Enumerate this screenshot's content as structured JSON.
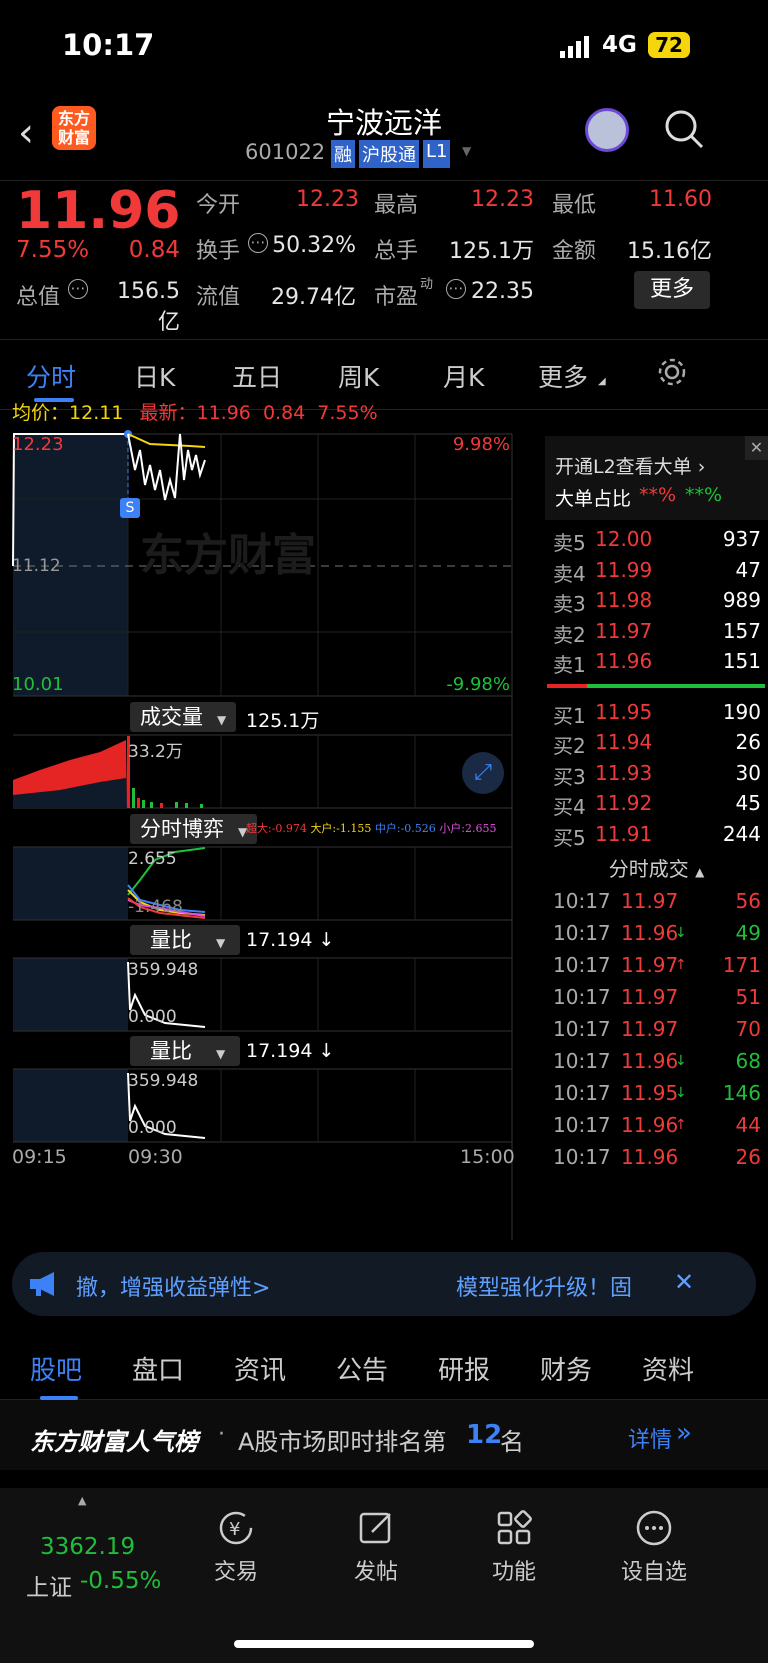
{
  "status": {
    "time": "10:17",
    "network": "4G",
    "battery": "72"
  },
  "header": {
    "logo": "东方财富",
    "name": "宁波远洋",
    "code": "601022",
    "tags": [
      "融",
      "沪股通",
      "L1"
    ]
  },
  "quote": {
    "price": "11.96",
    "pct": "7.55%",
    "change": "0.84",
    "fields": [
      {
        "label": "今开",
        "value": "12.23"
      },
      {
        "label": "最高",
        "value": "12.23"
      },
      {
        "label": "最低",
        "value": "11.60"
      },
      {
        "label": "换手",
        "value": "50.32%"
      },
      {
        "label": "总手",
        "value": "125.1万"
      },
      {
        "label": "金额",
        "value": "15.16亿"
      },
      {
        "label": "总值",
        "value": "156.5亿"
      },
      {
        "label": "流值",
        "value": "29.74亿"
      },
      {
        "label": "市盈",
        "sup": "动",
        "value": "22.35"
      }
    ],
    "more": "更多"
  },
  "tabs": [
    "分时",
    "日K",
    "五日",
    "周K",
    "月K",
    "更多"
  ],
  "chart": {
    "avg_label": "均价：",
    "avg": "12.11",
    "latest_label": "最新：",
    "latest": "11.96",
    "latest_chg": "0.84",
    "latest_pct": "7.55%",
    "price_high": "12.23",
    "price_mid": "11.12",
    "price_low": "10.01",
    "pct_high": "9.98%",
    "pct_low": "-9.98%",
    "watermark": "东方财富",
    "s_marker": "S",
    "vol_label": "成交量",
    "vol_value": "125.1万",
    "vol_max": "33.2万",
    "game_label": "分时博弈",
    "game_legend": [
      {
        "k": "超大:",
        "v": "-0.974"
      },
      {
        "k": "大户:",
        "v": "-1.155"
      },
      {
        "k": "中户:",
        "v": "-0.526"
      },
      {
        "k": "小户:",
        "v": "2.655"
      }
    ],
    "game_max": "2.655",
    "game_min": "-1.468",
    "ratio_label": "量比",
    "ratio_value": "17.194 ↓",
    "ratio_max": "359.948",
    "ratio_min": "0.000",
    "ratio2_label": "量比",
    "ratio2_value": "17.194 ↓",
    "ratio2_max": "359.948",
    "ratio2_min": "0.000",
    "time_start": "09:15",
    "time_open": "09:30",
    "time_end": "15:00"
  },
  "l2": {
    "line1": "开通L2查看大单 ›",
    "line2_label": "大单占比",
    "red": "**%",
    "green": "**%"
  },
  "book": {
    "asks": [
      {
        "l": "卖5",
        "p": "12.00",
        "v": "937"
      },
      {
        "l": "卖4",
        "p": "11.99",
        "v": "47"
      },
      {
        "l": "卖3",
        "p": "11.98",
        "v": "989"
      },
      {
        "l": "卖2",
        "p": "11.97",
        "v": "157"
      },
      {
        "l": "卖1",
        "p": "11.96",
        "v": "151"
      }
    ],
    "bids": [
      {
        "l": "买1",
        "p": "11.95",
        "v": "190"
      },
      {
        "l": "买2",
        "p": "11.94",
        "v": "26"
      },
      {
        "l": "买3",
        "p": "11.93",
        "v": "30"
      },
      {
        "l": "买4",
        "p": "11.92",
        "v": "45"
      },
      {
        "l": "买5",
        "p": "11.91",
        "v": "244"
      }
    ],
    "trades_title": "分时成交",
    "trades": [
      {
        "t": "10:17",
        "p": "11.97",
        "a": "",
        "v": "56",
        "vc": "red"
      },
      {
        "t": "10:17",
        "p": "11.96",
        "a": "↓",
        "v": "49",
        "vc": "green"
      },
      {
        "t": "10:17",
        "p": "11.97",
        "a": "↑",
        "v": "171",
        "vc": "red"
      },
      {
        "t": "10:17",
        "p": "11.97",
        "a": "",
        "v": "51",
        "vc": "red"
      },
      {
        "t": "10:17",
        "p": "11.97",
        "a": "",
        "v": "70",
        "vc": "red"
      },
      {
        "t": "10:17",
        "p": "11.96",
        "a": "↓",
        "v": "68",
        "vc": "green"
      },
      {
        "t": "10:17",
        "p": "11.95",
        "a": "↓",
        "v": "146",
        "vc": "green"
      },
      {
        "t": "10:17",
        "p": "11.96",
        "a": "↑",
        "v": "44",
        "vc": "red"
      },
      {
        "t": "10:17",
        "p": "11.96",
        "a": "",
        "v": "26",
        "vc": "red"
      }
    ]
  },
  "banner": {
    "left": "撤，增强收益弹性>",
    "right": "模型强化升级！固"
  },
  "btabs": [
    "股吧",
    "盘口",
    "资讯",
    "公告",
    "研报",
    "财务",
    "资料"
  ],
  "rank": {
    "brand": "东方财富人气榜",
    "sep": "·",
    "text": "A股市场即时排名第",
    "num": "12",
    "suffix": "名",
    "link": "详情"
  },
  "nav": {
    "index_value": "3362.19",
    "index_name": "上证",
    "index_pct": "-0.55%",
    "items": [
      "交易",
      "发帖",
      "功能",
      "设自选"
    ]
  }
}
